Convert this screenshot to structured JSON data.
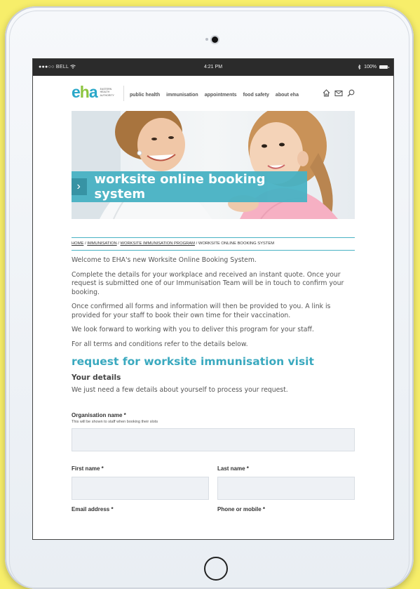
{
  "status_bar": {
    "carrier": "●●●○○ BELL",
    "time": "4:21 PM",
    "battery": "100%"
  },
  "logo": {
    "letters": [
      "e",
      "h",
      "a"
    ],
    "subtitle": "EASTERN HEALTH AUTHORITY"
  },
  "nav": {
    "items": [
      "public health",
      "immunisation",
      "appointments",
      "food safety",
      "about eha"
    ]
  },
  "icons": [
    "home-icon",
    "mail-icon",
    "search-icon",
    "chevron-right-icon",
    "bluetooth-icon",
    "battery-icon",
    "wifi-icon"
  ],
  "hero": {
    "banner_title": "worksite online booking system"
  },
  "breadcrumb": {
    "items": [
      "HOME",
      "IMMUNISATION",
      "WORKSITE IMMUNISATION PROGRAM"
    ],
    "current": "WORKSITE ONLINE BOOKING SYSTEM"
  },
  "intro": [
    "Welcome to EHA's new Worksite Online Booking System.",
    "Complete the details for your workplace and received an instant quote.  Once your request is submitted one of our Immunisation Team will be in touch to confirm your booking.",
    "Once confirmed all forms and information will then be provided to you.  A link is provided for your staff to book their own time for their vaccination.",
    "We look forward to working with you to deliver this program for your staff.",
    "For all terms and conditions refer to the details below."
  ],
  "form": {
    "title": "request for worksite immunisation visit",
    "section_title": "Your details",
    "section_intro": "We just need a few details about yourself to process your request.",
    "org_label": "Organisation name *",
    "org_hint": "This will be shown to staff when booking their slots",
    "first_name_label": "First name *",
    "last_name_label": "Last name *",
    "email_label": "Email address *",
    "phone_label": "Phone or mobile *"
  },
  "colors": {
    "accent": "#48b2c4",
    "background": "#f7ee6a",
    "green": "#8cc43f"
  }
}
